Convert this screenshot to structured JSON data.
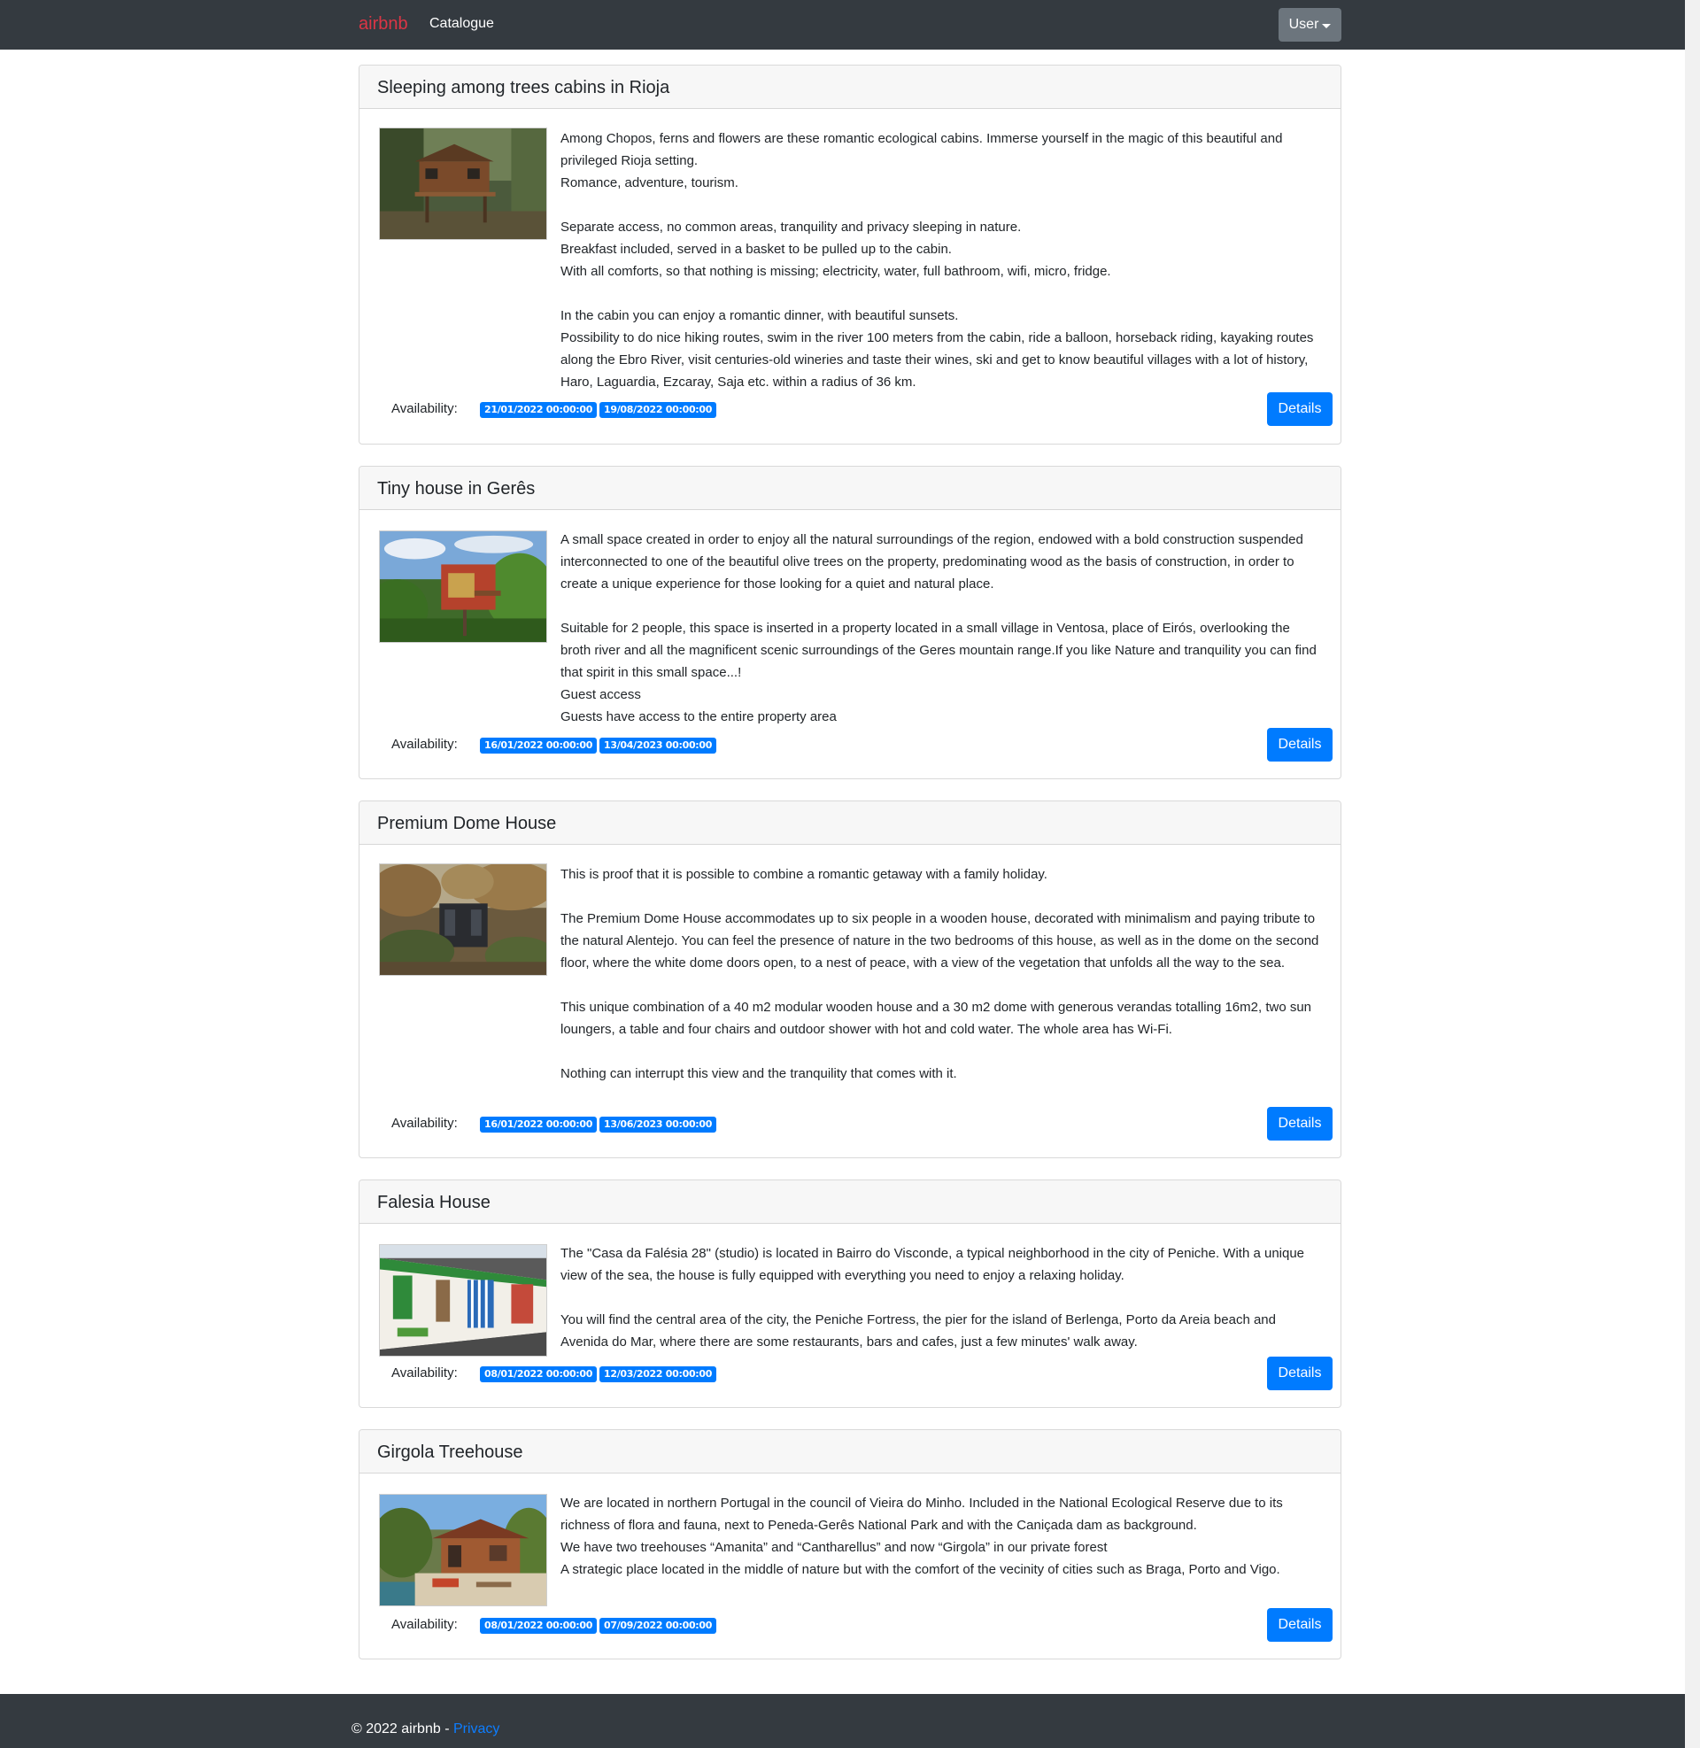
{
  "navbar": {
    "brand": "airbnb",
    "catalogue_link": "Catalogue",
    "user_menu": "User"
  },
  "listings": [
    {
      "title": "Sleeping among trees cabins in Rioja",
      "description": [
        "Among Chopos, ferns and flowers are these romantic ecological cabins. Immerse yourself in the magic of this beautiful and privileged Rioja setting.",
        "Romance, adventure, tourism.",
        "",
        "Separate access, no common areas, tranquility and privacy sleeping in nature.",
        "Breakfast included, served in a basket to be pulled up to the cabin.",
        "With all comforts, so that nothing is missing; electricity, water, full bathroom, wifi, micro, fridge.",
        "",
        "In the cabin you can enjoy a romantic dinner, with beautiful sunsets.",
        "Possibility to do nice hiking routes, swim in the river 100 meters from the cabin, ride a balloon, horseback riding, kayaking routes along the Ebro River, visit centuries-old wineries and taste their wines, ski and get to know beautiful villages with a lot of history, Haro, Laguardia, Ezcaray, Saja etc. within a radius of 36 km."
      ],
      "availability_label": "Availability:",
      "start_date": "21/01/2022 00:00:00",
      "end_date": "19/08/2022 00:00:00",
      "details_label": "Details",
      "image": "cabin-photo"
    },
    {
      "title": "Tiny house in Gerês",
      "description": [
        "A small space created in order to enjoy all the natural surroundings of the region, endowed with a bold construction suspended interconnected to one of the beautiful olive trees on the property, predominating wood as the basis of construction, in order to create a unique experience for those looking for a quiet and natural place.",
        "",
        "Suitable for 2 people, this space is inserted in a property located in a small village in Ventosa, place of Eirós, overlooking the broth river and all the magnificent scenic surroundings of the Geres mountain range.If you like Nature and tranquility you can find that spirit in this small space...!",
        "Guest access",
        "Guests have access to the entire property area"
      ],
      "availability_label": "Availability:",
      "start_date": "16/01/2022 00:00:00",
      "end_date": "13/04/2023 00:00:00",
      "details_label": "Details",
      "image": "tiny-house-photo"
    },
    {
      "title": "Premium Dome House",
      "description": [
        "This is proof that it is possible to combine a romantic getaway with a family holiday.",
        "",
        "The Premium Dome House accommodates up to six people in a wooden house, decorated with minimalism and paying tribute to the natural Alentejo. You can feel the presence of nature in the two bedrooms of this house, as well as in the dome on the second floor, where the white dome doors open, to a nest of peace, with a view of the vegetation that unfolds all the way to the sea.",
        "",
        "This unique combination of a 40 m2 modular wooden house and a 30 m2 dome with generous verandas totalling 16m2, two sun loungers, a table and four chairs and outdoor shower with hot and cold water. The whole area has Wi-Fi.",
        "",
        "Nothing can interrupt this view and the tranquility that comes with it."
      ],
      "availability_label": "Availability:",
      "start_date": "16/01/2022 00:00:00",
      "end_date": "13/06/2023 00:00:00",
      "details_label": "Details",
      "image": "dome-house-photo"
    },
    {
      "title": "Falesia House",
      "description": [
        "The \"Casa da Falésia 28\" (studio) is located in Bairro do Visconde, a typical neighborhood in the city of Peniche. With a unique view of the sea, the house is fully equipped with everything you need to enjoy a relaxing holiday.",
        "",
        "You will find the central area of the city, the Peniche Fortress, the pier for the island of Berlenga, Porto da Areia beach and Avenida do Mar, where there are some restaurants, bars and cafes, just a few minutes' walk away."
      ],
      "availability_label": "Availability:",
      "start_date": "08/01/2022 00:00:00",
      "end_date": "12/03/2022 00:00:00",
      "details_label": "Details",
      "image": "falesia-house-photo"
    },
    {
      "title": "Girgola Treehouse",
      "description": [
        "We are located in northern Portugal in the council of Vieira do Minho. Included in the National Ecological Reserve due to its richness of flora and fauna, next to Peneda-Gerês National Park and with the Caniçada dam as background.",
        "We have two treehouses “Amanita” and “Cantharellus” and now “Girgola” in our private forest",
        "A strategic place located in the middle of nature but with the comfort of the vecinity of cities such as Braga, Porto and Vigo."
      ],
      "availability_label": "Availability:",
      "start_date": "08/01/2022 00:00:00",
      "end_date": "07/09/2022 00:00:00",
      "details_label": "Details",
      "image": "treehouse-photo"
    }
  ],
  "footer": {
    "copyright": "© 2022 airbnb - ",
    "privacy_link": "Privacy"
  }
}
